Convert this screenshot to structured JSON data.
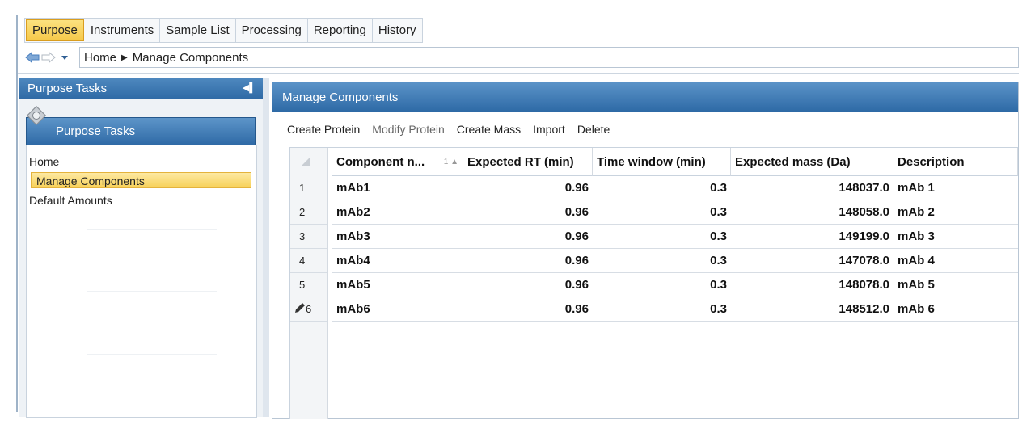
{
  "tabs": [
    {
      "label": "Purpose",
      "active": true
    },
    {
      "label": "Instruments",
      "active": false
    },
    {
      "label": "Sample List",
      "active": false
    },
    {
      "label": "Processing",
      "active": false
    },
    {
      "label": "Reporting",
      "active": false
    },
    {
      "label": "History",
      "active": false
    }
  ],
  "breadcrumb": {
    "home": "Home",
    "current": "Manage Components"
  },
  "left_pane": {
    "header": "Purpose Tasks",
    "group_title": "Purpose Tasks",
    "items": [
      {
        "label": "Home",
        "selected": false
      },
      {
        "label": "Manage Components",
        "selected": true
      },
      {
        "label": "Default Amounts",
        "selected": false
      }
    ]
  },
  "main": {
    "title": "Manage Components",
    "toolbar": [
      {
        "label": "Create Protein",
        "enabled": true
      },
      {
        "label": "Modify Protein",
        "enabled": false
      },
      {
        "label": "Create Mass",
        "enabled": true
      },
      {
        "label": "Import",
        "enabled": true
      },
      {
        "label": "Delete",
        "enabled": true
      }
    ],
    "columns": [
      "Component n...",
      "Expected RT (min)",
      "Time window (min)",
      "Expected mass (Da)",
      "Description"
    ],
    "sort_indicator": "1",
    "rows": [
      {
        "num": "1",
        "name": "mAb1",
        "rt": "0.96",
        "window": "0.3",
        "mass": "148037.0",
        "desc": "mAb 1"
      },
      {
        "num": "2",
        "name": "mAb2",
        "rt": "0.96",
        "window": "0.3",
        "mass": "148058.0",
        "desc": "mAb 2"
      },
      {
        "num": "3",
        "name": "mAb3",
        "rt": "0.96",
        "window": "0.3",
        "mass": "149199.0",
        "desc": "mAb 3"
      },
      {
        "num": "4",
        "name": "mAb4",
        "rt": "0.96",
        "window": "0.3",
        "mass": "147078.0",
        "desc": "mAb 4"
      },
      {
        "num": "5",
        "name": "mAb5",
        "rt": "0.96",
        "window": "0.3",
        "mass": "148078.0",
        "desc": "mAb 5"
      },
      {
        "num": "6",
        "name": "mAb6",
        "rt": "0.96",
        "window": "0.3",
        "mass": "148512.0",
        "desc": "mAb 6"
      }
    ]
  },
  "colors": {
    "accent_blue": "#2f6aa6",
    "selection_yellow": "#f7d15a"
  },
  "icons": [
    "back-arrow-icon",
    "forward-arrow-icon",
    "dropdown-icon",
    "breadcrumb-separator-icon",
    "collapse-pane-icon",
    "purpose-tasks-icon",
    "select-all-icon",
    "sort-asc-icon",
    "pencil-edit-icon"
  ]
}
